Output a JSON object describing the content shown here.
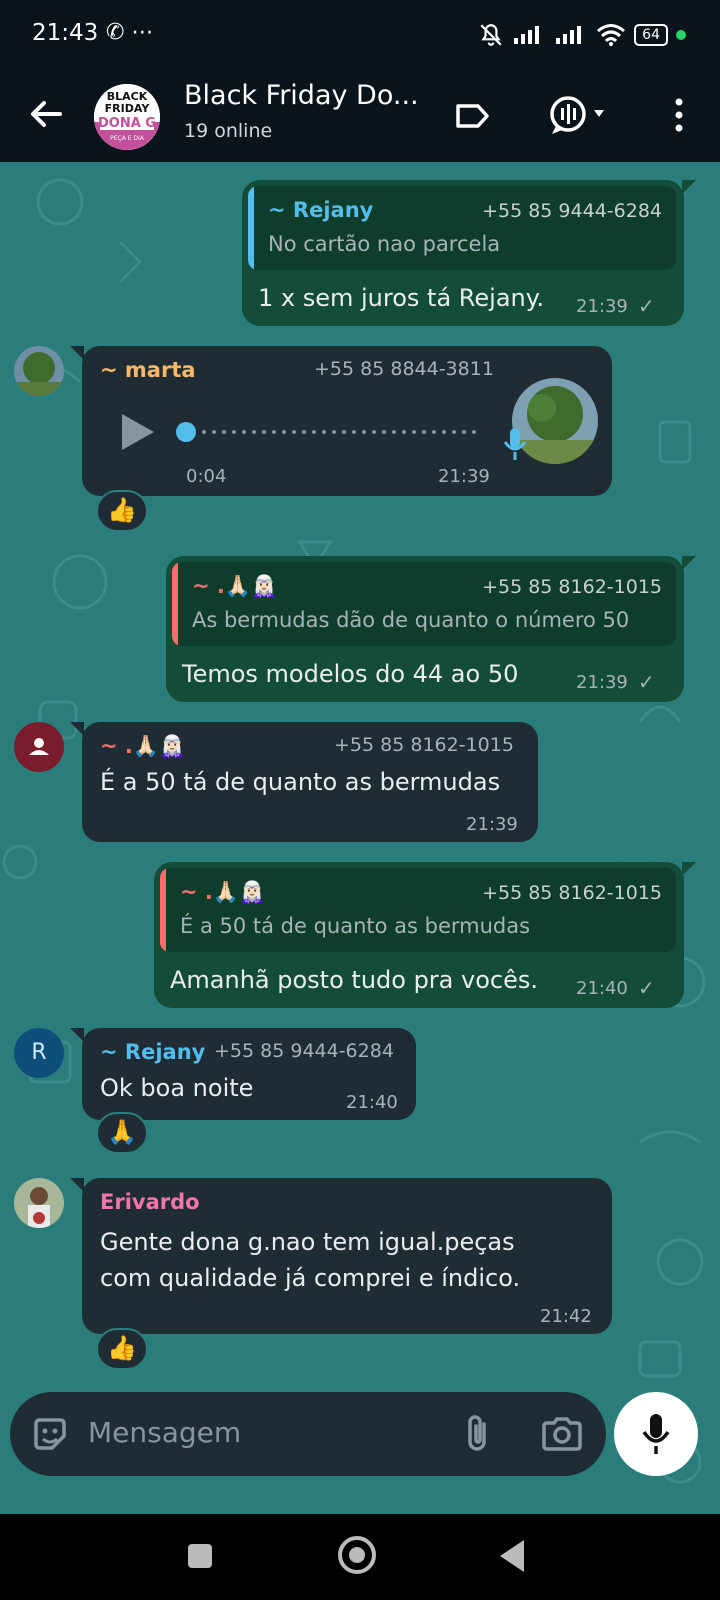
{
  "status_bar": {
    "time": "21:43",
    "left_icons": "✆ ⋯",
    "battery": "64"
  },
  "header": {
    "title": "Black Friday Do...",
    "subtitle": "19 online",
    "avatar_text": {
      "line1": "BLACK",
      "line2": "FRIDAY",
      "line3": "DONA G",
      "line4": "PEÇA E DIA"
    }
  },
  "messages": [
    {
      "type": "outgoing",
      "quote": {
        "name": "~ Rejany",
        "phone": "+55 85 9444-6284",
        "text": "No cartão  nao parcela"
      },
      "text": "1 x sem juros tá Rejany.",
      "time": "21:39",
      "status": "✓"
    },
    {
      "type": "incoming-audio",
      "sender": "~ marta",
      "phone": "+55 85 8844-3811",
      "duration": "0:04",
      "time": "21:39",
      "reaction": "👍"
    },
    {
      "type": "outgoing",
      "quote": {
        "name": "~ .🙏🏻🧝🏻‍♀️",
        "phone": "+55 85 8162-1015",
        "text": "As bermudas dão de quanto o número 50"
      },
      "text": "Temos modelos do 44 ao 50",
      "time": "21:39",
      "status": "✓"
    },
    {
      "type": "incoming",
      "sender": "~ .🙏🏻🧝🏻‍♀️",
      "phone": "+55 85 8162-1015",
      "text": "É a 50 tá de quanto as bermudas",
      "time": "21:39"
    },
    {
      "type": "outgoing",
      "quote": {
        "name": "~ .🙏🏻🧝🏻‍♀️",
        "phone": "+55 85 8162-1015",
        "text": "É a 50 tá de quanto as bermudas"
      },
      "text": "Amanhã posto tudo pra vocês.",
      "time": "21:40",
      "status": "✓"
    },
    {
      "type": "incoming",
      "sender": "~ Rejany",
      "phone": "+55 85 9444-6284",
      "avatar_letter": "R",
      "text": "Ok boa noite",
      "time": "21:40",
      "reaction": "🙏"
    },
    {
      "type": "incoming",
      "sender": "Erivardo",
      "text_line1": "Gente dona g.nao tem igual.peças",
      "text_line2": "com qualidade já comprei e índico.",
      "time": "21:42",
      "reaction": "👍"
    }
  ],
  "input": {
    "placeholder": "Mensagem"
  },
  "colors": {
    "wallpaper": "#2b7d7c",
    "outgoing_bubble": "#144d37",
    "incoming_bubble": "#1f2c34",
    "rejany_name": "#53bdeb",
    "marta_name": "#ffb866",
    "pray_name": "#fc6d6e",
    "erivardo_name": "#f774a8"
  }
}
